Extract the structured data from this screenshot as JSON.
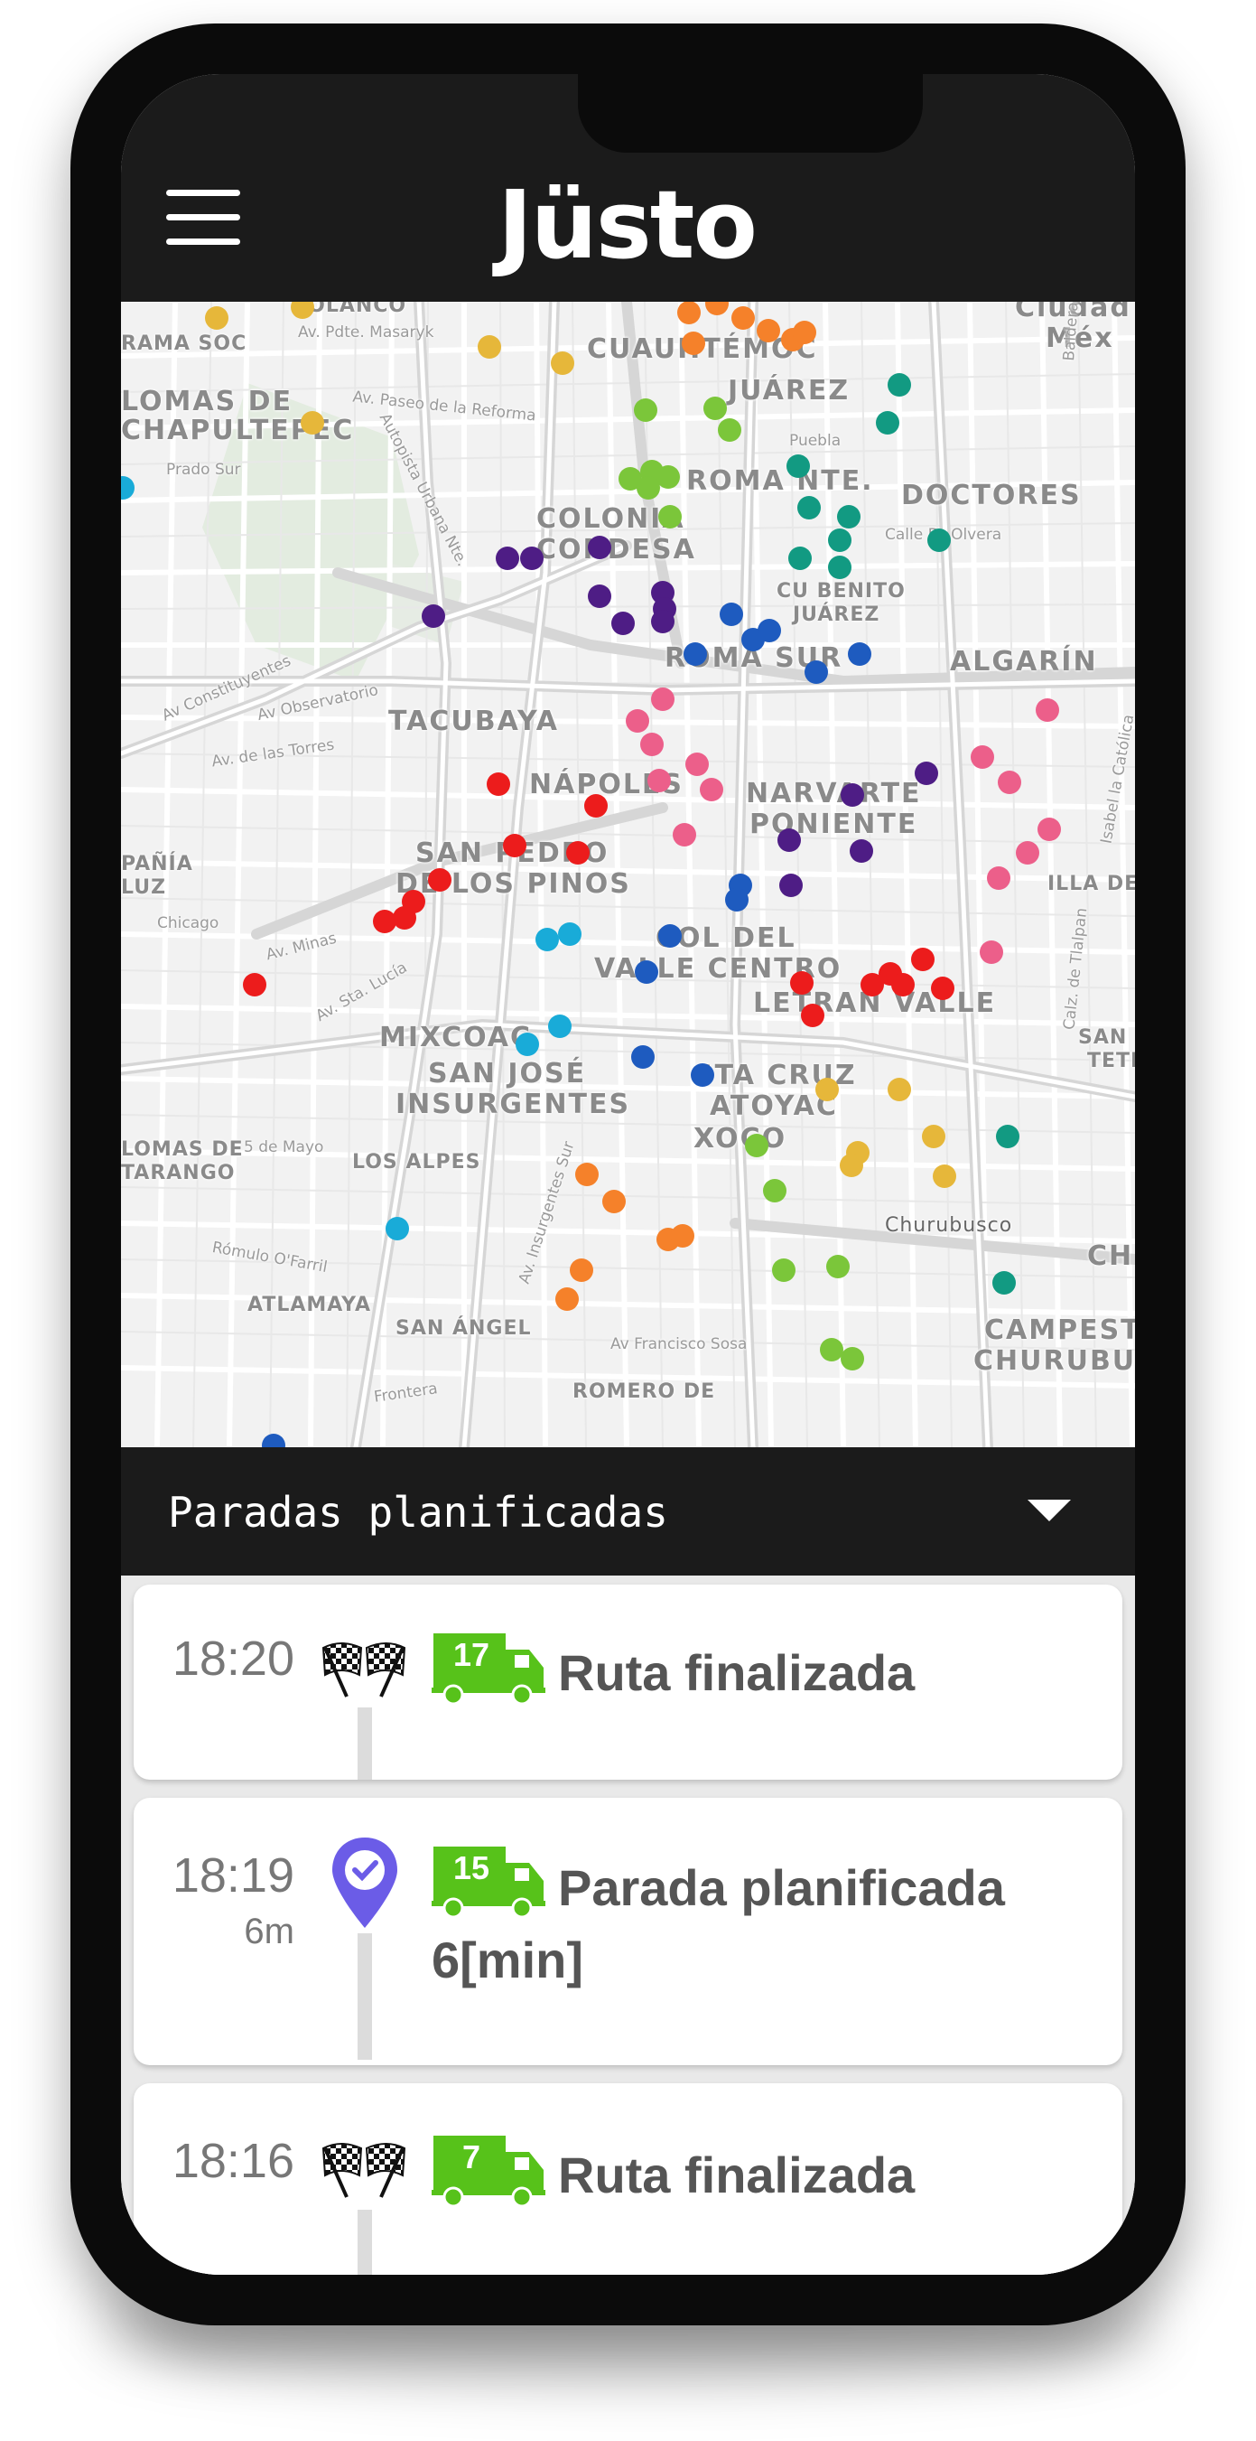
{
  "app": {
    "logo_text": "Jüsto",
    "brand_color": "#1b1b1b",
    "accent_green": "#57c21a"
  },
  "header": {
    "menu_icon": "hamburger-menu-icon"
  },
  "map": {
    "labels": [
      "POLANCO",
      "CUAUHTÉMOC",
      "JUÁREZ",
      "LOMAS DE",
      "CHAPULTEPEC",
      "ROMA NTE.",
      "DOCTORES",
      "COLONIA",
      "CONDESA",
      "CU BENITO",
      "JUÁREZ",
      "ROMA SUR",
      "ALGARÍN",
      "TACUBAYA",
      "NÁPOLES",
      "NARVARTE",
      "PONIENTE",
      "SAN PEDRO",
      "DE LOS PINOS",
      "COL DEL",
      "VALLE CENTRO",
      "LETRAN VALLE",
      "MIXCOAC",
      "SAN JOSÉ",
      "INSURGENTES",
      "STA CRUZ",
      "ATOYAC",
      "XOCO",
      "LOS ALPES",
      "Churubusco",
      "ATLAMAYA",
      "SAN ÁNGEL",
      "CAMPESTRE",
      "CHURUBUSCO",
      "ROMERO DE",
      "Ciudad",
      "Méx",
      "LOMAS DE",
      "TARANGO",
      "PAÑÍA",
      "LUZ",
      "SAN",
      "TETE",
      "CH",
      "ILLA DE CO",
      "RAMA SOC"
    ],
    "streets": [
      "Av. Pdte. Masaryk",
      "Av. Paseo de la Reforma",
      "Autopista Urbana Nte.",
      "Av Constituyentes",
      "Av Observatorio",
      "Av. de las Torres",
      "Chicago",
      "Av. Minas",
      "Av. Sta. Lucía",
      "Av. Insurgentes Sur",
      "Av Francisco Sosa",
      "Rómulo O'Farril",
      "5 de Mayo",
      "Frontera",
      "Calle Dr Olvera",
      "Puebla",
      "Isabel la Católica",
      "Calz. de Tlalpan",
      "Prado Sur",
      "Balderas"
    ],
    "stop_colors": {
      "orange": "#f5812a",
      "yellow": "#e6b73a",
      "green": "#7bc63a",
      "teal": "#129a82",
      "purple": "#4e1d85",
      "blue": "#1e5bbf",
      "pink": "#ec5f8a",
      "red": "#ec1c1c",
      "cyan": "#19abd8"
    }
  },
  "panel": {
    "title": "Paradas planificadas",
    "toggle_icon": "caret-down-icon"
  },
  "stops": [
    {
      "time": "18:20",
      "duration": "",
      "icon": "checkered-flags-icon",
      "truck_number": "17",
      "label": "Ruta finalizada"
    },
    {
      "time": "18:19",
      "duration": "6m",
      "icon": "location-pin-check-icon",
      "truck_number": "15",
      "label": "Parada planificada 6[min]"
    },
    {
      "time": "18:16",
      "duration": "",
      "icon": "checkered-flags-icon",
      "truck_number": "7",
      "label": "Ruta finalizada"
    }
  ]
}
